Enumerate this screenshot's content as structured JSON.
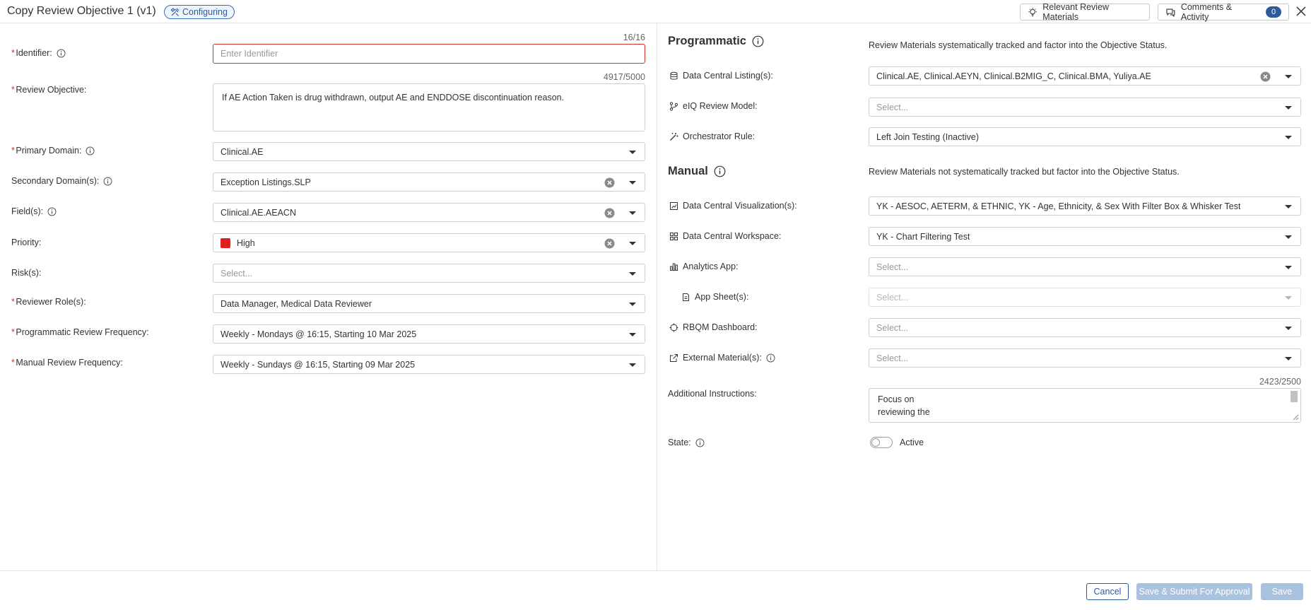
{
  "header": {
    "title": "Copy Review Objective 1 (v1)",
    "status_badge": "Configuring",
    "relevant_materials": "Relevant Review Materials",
    "comments": "Comments & Activity",
    "comments_count": "0"
  },
  "left": {
    "identifier": {
      "label": "Identifier:",
      "placeholder": "Enter Identifier",
      "counter": "16/16"
    },
    "review_objective": {
      "label": "Review Objective:",
      "value": "If AE Action Taken is drug withdrawn, output AE and ENDDOSE discontinuation reason.",
      "counter": "4917/5000"
    },
    "primary_domain": {
      "label": "Primary Domain:",
      "value": "Clinical.AE"
    },
    "secondary_domains": {
      "label": "Secondary Domain(s):",
      "value": "Exception Listings.SLP"
    },
    "fields": {
      "label": "Field(s):",
      "value": "Clinical.AE.AEACN"
    },
    "priority": {
      "label": "Priority:",
      "value": "High",
      "color": "#e02020"
    },
    "risks": {
      "label": "Risk(s):",
      "placeholder": "Select..."
    },
    "reviewer_roles": {
      "label": "Reviewer Role(s):",
      "value": "Data Manager, Medical Data Reviewer"
    },
    "programmatic_frequency": {
      "label": "Programmatic Review Frequency:",
      "value": "Weekly - Mondays @ 16:15, Starting 10 Mar 2025"
    },
    "manual_frequency": {
      "label": "Manual Review Frequency:",
      "value": "Weekly - Sundays @ 16:15, Starting 09 Mar 2025"
    }
  },
  "right": {
    "programmatic": {
      "title": "Programmatic",
      "description": "Review Materials systematically tracked and factor into the Objective Status."
    },
    "listings": {
      "label": "Data Central Listing(s):",
      "value": "Clinical.AE, Clinical.AEYN, Clinical.B2MIG_C, Clinical.BMA, Yuliya.AE"
    },
    "eiq_model": {
      "label": "eIQ Review Model:",
      "placeholder": "Select..."
    },
    "orchestrator_rule": {
      "label": "Orchestrator Rule:",
      "value": "Left Join Testing (Inactive)"
    },
    "manual": {
      "title": "Manual",
      "description": "Review Materials not systematically tracked but factor into the Objective Status."
    },
    "visualizations": {
      "label": "Data Central Visualization(s):",
      "value": "YK - AESOC, AETERM, & ETHNIC, YK - Age, Ethnicity, & Sex With Filter Box & Whisker Test"
    },
    "workspace": {
      "label": "Data Central Workspace:",
      "value": "YK - Chart Filtering Test"
    },
    "analytics_app": {
      "label": "Analytics App:",
      "placeholder": "Select..."
    },
    "app_sheets": {
      "label": "App Sheet(s):",
      "placeholder": "Select..."
    },
    "rbqm_dashboard": {
      "label": "RBQM Dashboard:",
      "placeholder": "Select..."
    },
    "external_materials": {
      "label": "External Material(s):",
      "placeholder": "Select..."
    },
    "additional_instructions": {
      "label": "Additional Instructions:",
      "counter": "2423/2500",
      "line1": "Focus on",
      "line2": "reviewing the"
    },
    "state": {
      "label": "State:",
      "value": "Active"
    }
  },
  "footer": {
    "cancel": "Cancel",
    "submit": "Save & Submit For Approval",
    "save": "Save"
  }
}
